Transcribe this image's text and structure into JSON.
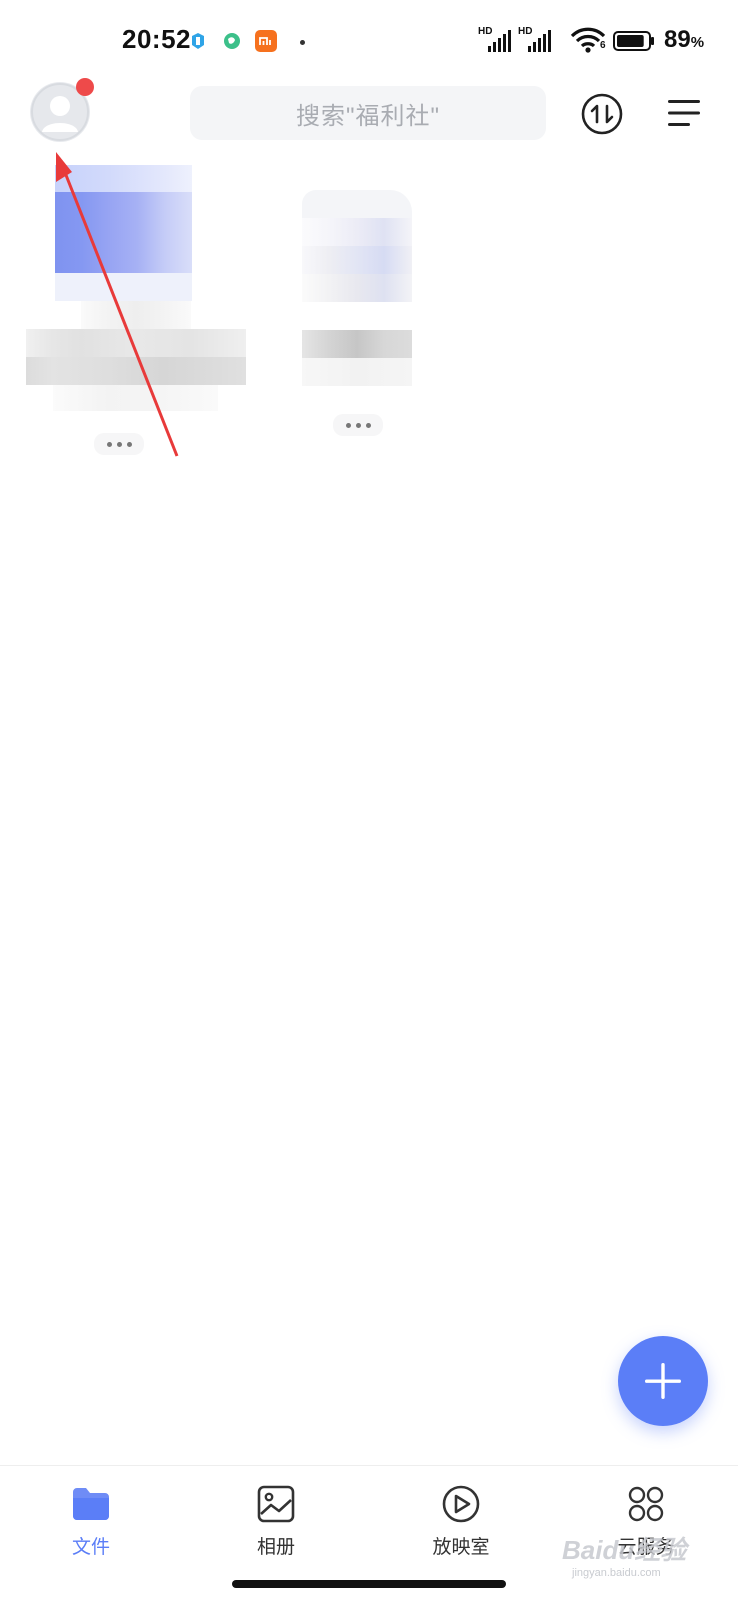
{
  "status_bar": {
    "time": "20:52",
    "signal_label_1": "HD",
    "signal_label_2": "HD",
    "wifi_label": "6",
    "battery_value": "89",
    "battery_unit": "%",
    "battery_level": 0.89
  },
  "header": {
    "avatar_icon": "user-avatar-icon",
    "has_notification_badge": true,
    "search_placeholder": "搜索\"福利社\"",
    "transfer_icon": "transfer-up-down-icon",
    "menu_icon": "hamburger-menu-icon"
  },
  "files": {
    "items": [
      {
        "kind": "blurred-folder"
      },
      {
        "kind": "blurred-document"
      }
    ]
  },
  "fab": {
    "icon": "plus-icon"
  },
  "bottom_nav": {
    "items": [
      {
        "label": "文件",
        "icon": "folder-icon",
        "active": true
      },
      {
        "label": "相册",
        "icon": "album-icon",
        "active": false
      },
      {
        "label": "放映室",
        "icon": "play-icon",
        "active": false
      },
      {
        "label": "云服务",
        "icon": "grid-icon",
        "active": false
      }
    ]
  },
  "watermark": {
    "brand": "Baidu经验",
    "url": "jingyan.baidu.com"
  },
  "colors": {
    "accent": "#5b7ef7",
    "badge": "#ee4a4a",
    "annotation": "#e83a3a"
  }
}
